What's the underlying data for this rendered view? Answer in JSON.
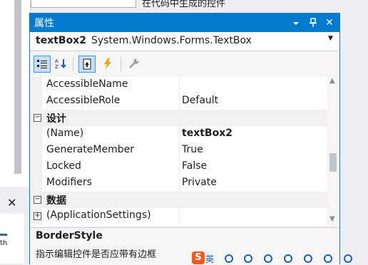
{
  "window": {
    "title": "属性",
    "dropdown_icon": "chevron-down-icon",
    "pin_icon": "pin-icon",
    "close_icon": "close-icon",
    "accent_color": "#007acc"
  },
  "object_selector": {
    "name": "textBox2",
    "type": "System.Windows.Forms.TextBox"
  },
  "toolbar": {
    "categorized": "categorized-icon",
    "alphabetical": "alphabetical-icon",
    "properties": "properties-icon",
    "events": "events-icon",
    "property_pages": "property-pages-icon"
  },
  "grid": {
    "rows": [
      {
        "kind": "prop",
        "name": "AccessibleName",
        "value": ""
      },
      {
        "kind": "prop",
        "name": "AccessibleRole",
        "value": "Default"
      },
      {
        "kind": "category",
        "name": "设计",
        "toggle": "⊟"
      },
      {
        "kind": "prop",
        "name": "(Name)",
        "value": "textBox2",
        "bold": true
      },
      {
        "kind": "prop",
        "name": "GenerateMember",
        "value": "True"
      },
      {
        "kind": "prop",
        "name": "Locked",
        "value": "False"
      },
      {
        "kind": "prop",
        "name": "Modifiers",
        "value": "Private"
      },
      {
        "kind": "category",
        "name": "数据",
        "toggle": "⊟"
      },
      {
        "kind": "expandable",
        "name": "(ApplicationSettings)",
        "value": "",
        "toggle": "⊞"
      }
    ]
  },
  "description": {
    "title": "BorderStyle",
    "text": "指示编辑控件是否应带有边框"
  },
  "background": {
    "left_partial_text": "th",
    "top_partial_text": "在代码中生成的控件"
  },
  "taskbar": {
    "sogou_label": "S",
    "ime_label": "英"
  }
}
